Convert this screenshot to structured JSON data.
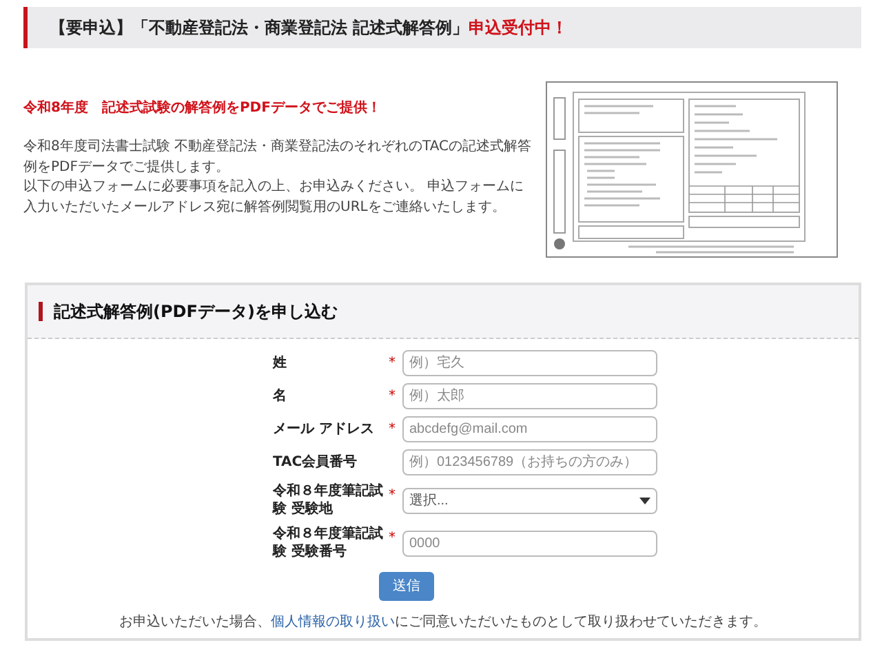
{
  "header": {
    "title": "【要申込】「不動産登記法・商業登記法 記述式解答例」",
    "status": "申込受付中！"
  },
  "intro": {
    "headline": "令和8年度　記述式試験の解答例をPDFデータでご提供！",
    "paragraphs": [
      "令和8年度司法書士試験 不動産登記法・商業登記法のそれぞれのTACの記述式解答例をPDFデータでご提供します。",
      "以下の申込フォームに必要事項を記入の上、お申込みください。 申込フォームに入力いただいたメールアドレス宛に解答例閲覧用のURLをご連絡いたします。"
    ],
    "preview": {
      "kind": "document"
    }
  },
  "form": {
    "title": "記述式解答例(PDFデータ)を申し込む",
    "fields": [
      {
        "label": "姓",
        "mark": "*",
        "kind": "text",
        "placeholder": "例）宅久"
      },
      {
        "label": "名",
        "mark": "*",
        "kind": "text",
        "placeholder": "例）太郎"
      },
      {
        "label": "メール アドレス",
        "mark": "*",
        "kind": "text",
        "placeholder": "abcdefg@mail.com"
      },
      {
        "label": "TAC会員番号",
        "kind": "text",
        "placeholder": "例）0123456789（お持ちの方のみ）"
      },
      {
        "label": "令和８年度筆記試験 受験地",
        "mark": "*",
        "kind": "select",
        "value": "選択..."
      },
      {
        "label": "令和８年度筆記試験 受験番号",
        "mark": "*",
        "kind": "text",
        "placeholder": "0000"
      }
    ],
    "submit": "送信",
    "notice": {
      "before": "お申込いただいた場合、",
      "link": "個人情報の取り扱い",
      "after": "にご同意いただいたものとして取り扱わせていただきます。"
    }
  }
}
